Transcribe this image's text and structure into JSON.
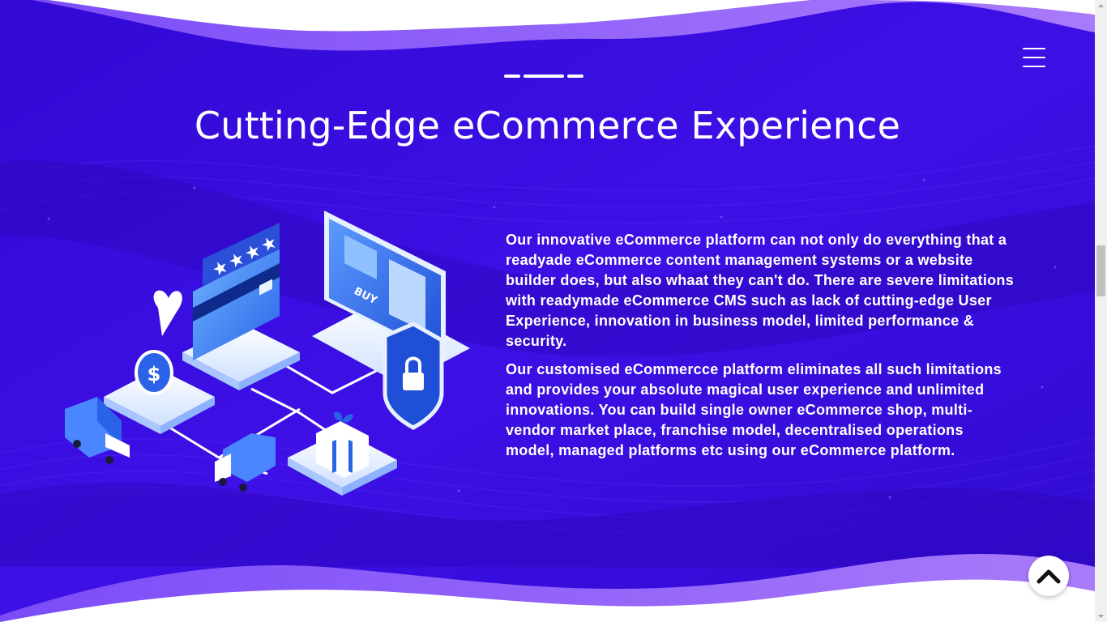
{
  "section": {
    "title": "Cutting-Edge eCommerce Experience",
    "paragraphs": [
      "Our innovative eCommerce platform can not only do everything that a readyade eCommerce content management systems or a website builder does, but also whaat they can't do. There are severe limitations with readymade eCommerce CMS such as lack of cutting-edge User Experience, innovation in business model, limited performance & security.",
      "Our customised eCommercce platform eliminates all such limitations and provides your absolute magical user experience and unlimited innovations. You can build single owner eCommerce shop, multi-vendor market place, franchise model, decentralised operations model, managed platforms etc using our eCommerce platform."
    ]
  },
  "illustration": {
    "buy_label": "BUY",
    "dollar_label": "$",
    "stars": 4
  },
  "icons": {
    "menu": "hamburger-menu-icon",
    "back_to_top": "chevron-up-icon"
  },
  "colors": {
    "background": "#3a0ee0",
    "wave": "#8b5cf6",
    "text": "#ffffff"
  }
}
